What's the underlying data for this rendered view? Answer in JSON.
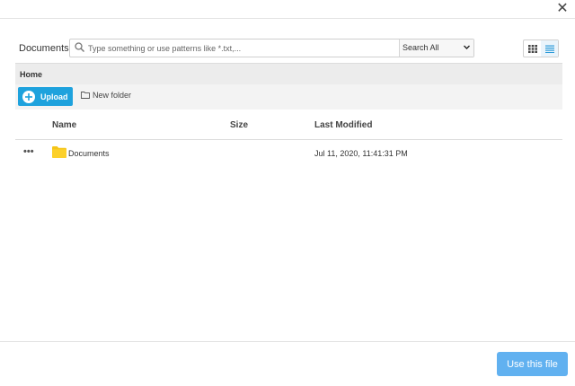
{
  "dialog": {
    "close_glyph": "✕",
    "location_label": "Documents",
    "search": {
      "value": "",
      "placeholder": "Type something or use patterns like *.txt,..."
    },
    "scope_select": {
      "selected": "Search All"
    },
    "view_toggle": {
      "icons": [
        "grid-view-icon",
        "list-view-icon"
      ],
      "active": "list"
    },
    "breadcrumb": "Home",
    "toolbar": {
      "upload_label": "Upload",
      "new_folder_label": "New folder"
    },
    "table": {
      "columns": [
        "Name",
        "Size",
        "Last Modified"
      ],
      "rows": [
        {
          "menu": "•••",
          "icon": "folder-icon",
          "name": "Documents",
          "size": "",
          "modified": "Jul 11, 2020, 11:41:31 PM"
        }
      ]
    },
    "footer": {
      "use_button_label": "Use this file"
    }
  },
  "colors": {
    "accent": "#1ea2dd",
    "primary_button": "#61b1f0",
    "folder": "#f5c518"
  }
}
